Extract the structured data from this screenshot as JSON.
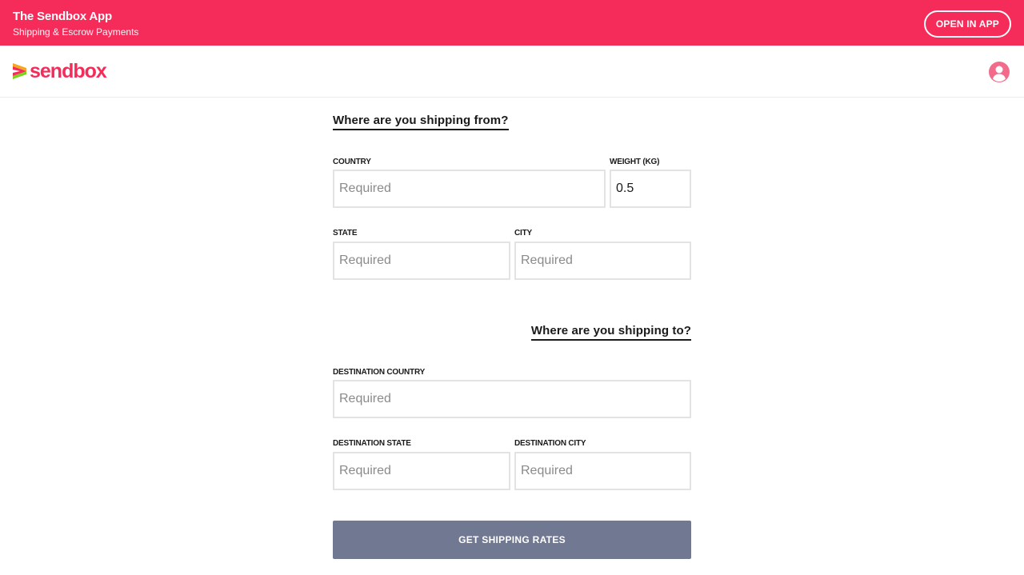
{
  "banner": {
    "title": "The Sendbox App",
    "subtitle": "Shipping & Escrow Payments",
    "open_button": "OPEN IN APP"
  },
  "header": {
    "logo_text": "sendbox",
    "brand_color": "#f52c5a",
    "user_icon": "user-circle-icon"
  },
  "form": {
    "from_heading": "Where are you shipping from?",
    "country": {
      "label": "COUNTRY",
      "placeholder": "Required",
      "value": ""
    },
    "weight": {
      "label": "WEIGHT (KG)",
      "placeholder": "",
      "value": "0.5"
    },
    "state": {
      "label": "STATE",
      "placeholder": "Required",
      "value": ""
    },
    "city": {
      "label": "CITY",
      "placeholder": "Required",
      "value": ""
    },
    "to_heading": "Where are you shipping to?",
    "dest_country": {
      "label": "DESTINATION COUNTRY",
      "placeholder": "Required",
      "value": ""
    },
    "dest_state": {
      "label": "DESTINATION STATE",
      "placeholder": "Required",
      "value": ""
    },
    "dest_city": {
      "label": "DESTINATION CITY",
      "placeholder": "Required",
      "value": ""
    },
    "submit_label": "GET SHIPPING RATES"
  },
  "colors": {
    "banner_bg": "#f52c5a",
    "button_bg": "#717891",
    "input_border": "#e3e3e3"
  }
}
